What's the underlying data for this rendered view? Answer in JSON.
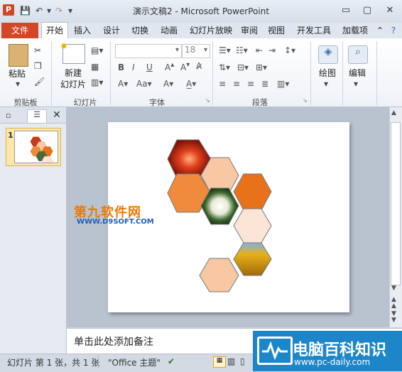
{
  "window": {
    "app_icon": "P",
    "title": "演示文稿2 - Microsoft PowerPoint",
    "minimize": "▭",
    "maximize": "▢",
    "close": "✕"
  },
  "tabs": {
    "file": "文件",
    "items": [
      "开始",
      "插入",
      "设计",
      "切换",
      "动画",
      "幻灯片放映",
      "审阅",
      "视图",
      "开发工具",
      "加载项"
    ]
  },
  "ribbon": {
    "clipboard": {
      "paste": "粘贴",
      "label": "剪贴板"
    },
    "slides": {
      "new_slide_1": "新建",
      "new_slide_2": "幻灯片",
      "label": "幻灯片"
    },
    "font": {
      "name": "",
      "size": "18",
      "label": "字体"
    },
    "paragraph": {
      "label": "段落"
    },
    "drawing": {
      "label": "绘图"
    },
    "editing": {
      "label": "编辑"
    }
  },
  "left_pane": {
    "slide_number": "1"
  },
  "notes": {
    "placeholder": "单击此处添加备注"
  },
  "status": {
    "slide_info": "幻灯片 第 1 张，共 1 张",
    "theme": "\"Office 主题\""
  },
  "watermarks": {
    "left_title": "第九软件网",
    "left_url": "WWW.D9SOFT.COM",
    "right_title": "电脑百科知识",
    "right_url": "www.pc-daily.com"
  },
  "colors": {
    "accent": "#d24726",
    "hex_light": "#f8c7a4",
    "hex_mid": "#f08a3c",
    "hex_dark": "#e8721a",
    "hex_pale": "#fce5d6"
  }
}
